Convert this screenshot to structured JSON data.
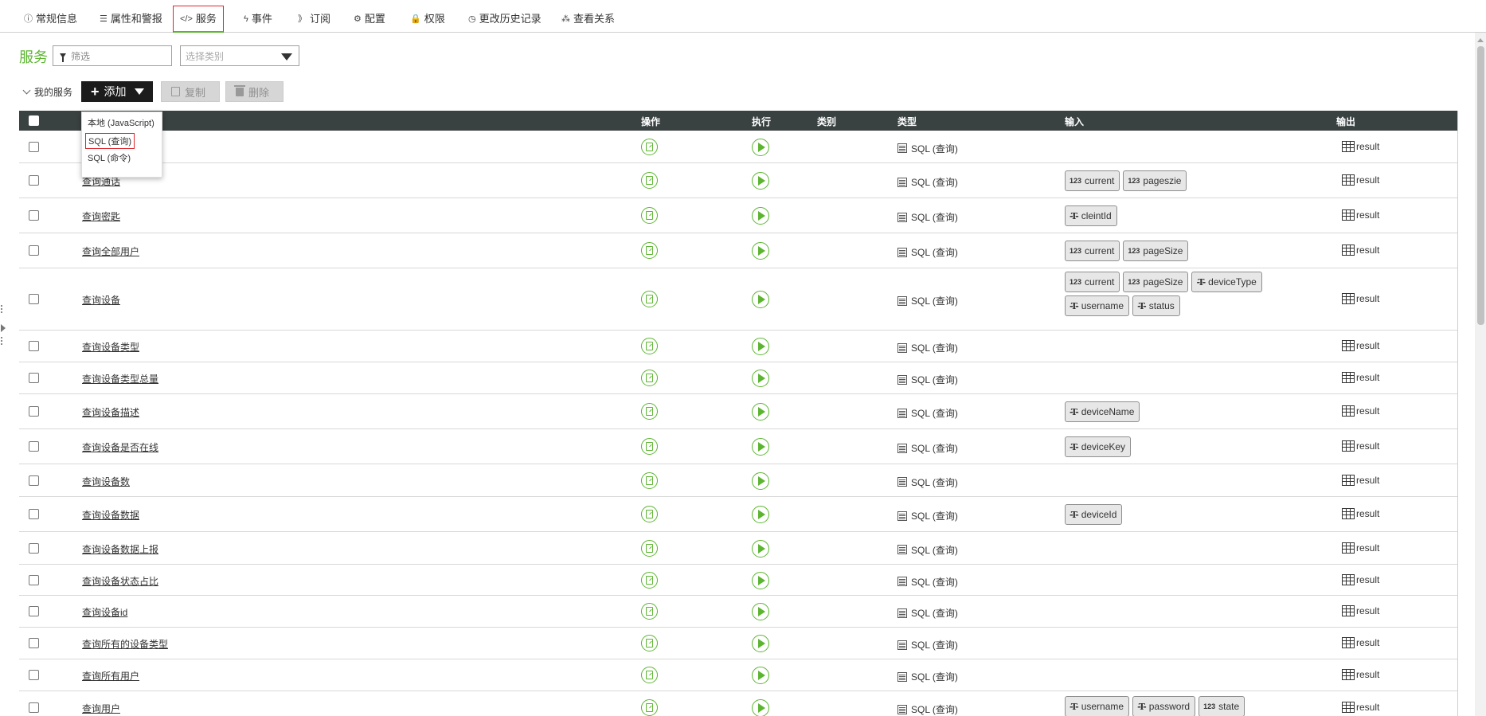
{
  "tabs": [
    {
      "key": "general",
      "label": "常规信息",
      "icon": "info-circle-icon",
      "glyph": "ⓘ"
    },
    {
      "key": "properties",
      "label": "属性和警报",
      "icon": "list-icon",
      "glyph": "☰"
    },
    {
      "key": "services",
      "label": "服务",
      "icon": "code-icon",
      "glyph": "</>"
    },
    {
      "key": "events",
      "label": "事件",
      "icon": "lightning-icon",
      "glyph": "ϟ"
    },
    {
      "key": "subscriptions",
      "label": "订阅",
      "icon": "rss-icon",
      "glyph": "》"
    },
    {
      "key": "config",
      "label": "配置",
      "icon": "gear-icon",
      "glyph": "⚙"
    },
    {
      "key": "permissions",
      "label": "权限",
      "icon": "lock-icon",
      "glyph": "🔒"
    },
    {
      "key": "history",
      "label": "更改历史记录",
      "icon": "clock-icon",
      "glyph": "◷"
    },
    {
      "key": "relations",
      "label": "查看关系",
      "icon": "relations-icon",
      "glyph": "⁂"
    }
  ],
  "active_tab": "services",
  "section": {
    "title": "服务",
    "filter_placeholder": "筛选",
    "category_placeholder": "选择类别",
    "my_services_label": "我的服务",
    "add_label": "添加",
    "copy_label": "复制",
    "delete_label": "删除"
  },
  "add_menu": {
    "options": [
      "本地 (JavaScript)",
      "SQL (查询)",
      "SQL (命令)"
    ],
    "highlighted_index": 1
  },
  "table": {
    "columns": {
      "action": "操作",
      "execute": "执行",
      "category": "类别",
      "type": "类型",
      "input": "输入",
      "output": "输出"
    },
    "rows": [
      {
        "name": "",
        "type": "SQL (查询)",
        "inputs": [],
        "output": "result"
      },
      {
        "name": "查询通话",
        "type": "SQL (查询)",
        "inputs": [
          {
            "t": "123",
            "n": "current"
          },
          {
            "t": "123",
            "n": "pageszie"
          }
        ],
        "output": "result"
      },
      {
        "name": "查询密匙",
        "type": "SQL (查询)",
        "inputs": [
          {
            "t": "T",
            "n": "cleintId"
          }
        ],
        "output": "result"
      },
      {
        "name": "查询全部用户",
        "type": "SQL (查询)",
        "inputs": [
          {
            "t": "123",
            "n": "current"
          },
          {
            "t": "123",
            "n": "pageSize"
          }
        ],
        "output": "result"
      },
      {
        "name": "查询设备",
        "type": "SQL (查询)",
        "inputs": [
          {
            "t": "123",
            "n": "current"
          },
          {
            "t": "123",
            "n": "pageSize"
          },
          {
            "t": "T",
            "n": "deviceType"
          },
          {
            "t": "T",
            "n": "username"
          },
          {
            "t": "T",
            "n": "status"
          }
        ],
        "output": "result"
      },
      {
        "name": "查询设备类型",
        "type": "SQL (查询)",
        "inputs": [],
        "output": "result"
      },
      {
        "name": "查询设备类型总量",
        "type": "SQL (查询)",
        "inputs": [],
        "output": "result"
      },
      {
        "name": "查询设备描述",
        "type": "SQL (查询)",
        "inputs": [
          {
            "t": "T",
            "n": "deviceName"
          }
        ],
        "output": "result"
      },
      {
        "name": "查询设备是否在线",
        "type": "SQL (查询)",
        "inputs": [
          {
            "t": "T",
            "n": "deviceKey"
          }
        ],
        "output": "result"
      },
      {
        "name": "查询设备数",
        "type": "SQL (查询)",
        "inputs": [],
        "output": "result"
      },
      {
        "name": "查询设备数据",
        "type": "SQL (查询)",
        "inputs": [
          {
            "t": "T",
            "n": "deviceId"
          }
        ],
        "output": "result"
      },
      {
        "name": "查询设备数据上报",
        "type": "SQL (查询)",
        "inputs": [],
        "output": "result"
      },
      {
        "name": "查询设备状态占比",
        "type": "SQL (查询)",
        "inputs": [],
        "output": "result"
      },
      {
        "name": "查询设备id",
        "type": "SQL (查询)",
        "inputs": [],
        "output": "result"
      },
      {
        "name": "查询所有的设备类型",
        "type": "SQL (查询)",
        "inputs": [],
        "output": "result"
      },
      {
        "name": "查询所有用户",
        "type": "SQL (查询)",
        "inputs": [],
        "output": "result"
      },
      {
        "name": "查询用户",
        "type": "SQL (查询)",
        "inputs": [
          {
            "t": "T",
            "n": "username"
          },
          {
            "t": "T",
            "n": "password"
          },
          {
            "t": "123",
            "n": "state"
          }
        ],
        "output": "result"
      }
    ]
  },
  "colors": {
    "accent_green": "#5cb531",
    "header_dark": "#3a4141",
    "active_red": "#e0282e"
  }
}
